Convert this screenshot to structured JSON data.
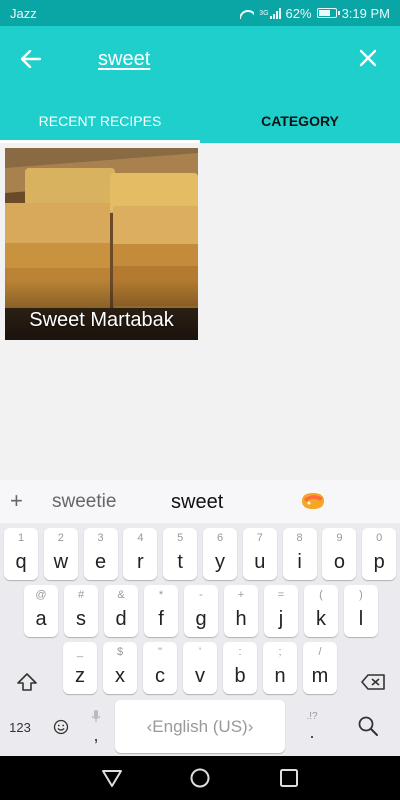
{
  "status_bar": {
    "carrier": "Jazz",
    "network": "3G",
    "battery": "62%",
    "time": "3:19 PM"
  },
  "app_bar": {
    "search_text": "sweet"
  },
  "tabs": [
    {
      "label": "RECENT RECIPES"
    },
    {
      "label": "CATEGORY"
    }
  ],
  "recipes": [
    {
      "title": "Sweet Martabak"
    }
  ],
  "keyboard": {
    "suggestions": {
      "plus": "+",
      "first": "sweetie",
      "second": "sweet",
      "emoji": "emoji-icon"
    },
    "row1": [
      {
        "hint": "1",
        "main": "q"
      },
      {
        "hint": "2",
        "main": "w"
      },
      {
        "hint": "3",
        "main": "e"
      },
      {
        "hint": "4",
        "main": "r"
      },
      {
        "hint": "5",
        "main": "t"
      },
      {
        "hint": "6",
        "main": "y"
      },
      {
        "hint": "7",
        "main": "u"
      },
      {
        "hint": "8",
        "main": "i"
      },
      {
        "hint": "9",
        "main": "o"
      },
      {
        "hint": "0",
        "main": "p"
      }
    ],
    "row2": [
      {
        "hint": "@",
        "main": "a"
      },
      {
        "hint": "#",
        "main": "s"
      },
      {
        "hint": "&",
        "main": "d"
      },
      {
        "hint": "*",
        "main": "f"
      },
      {
        "hint": "-",
        "main": "g"
      },
      {
        "hint": "+",
        "main": "h"
      },
      {
        "hint": "=",
        "main": "j"
      },
      {
        "hint": "(",
        "main": "k"
      },
      {
        "hint": ")",
        "main": "l"
      }
    ],
    "row3": [
      {
        "hint": "_",
        "main": "z"
      },
      {
        "hint": "$",
        "main": "x"
      },
      {
        "hint": "\"",
        "main": "c"
      },
      {
        "hint": "'",
        "main": "v"
      },
      {
        "hint": ":",
        "main": "b"
      },
      {
        "hint": ";",
        "main": "n"
      },
      {
        "hint": "/",
        "main": "m"
      }
    ],
    "symbols_label": "123",
    "comma": ",",
    "space_label": "English (US)",
    "period": ".",
    "period_hint": ".!?"
  }
}
